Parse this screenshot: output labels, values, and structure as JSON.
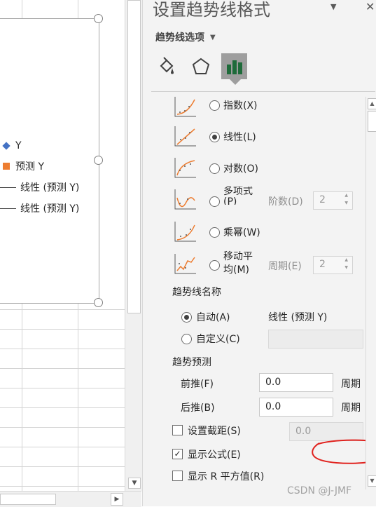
{
  "chart_legend": {
    "items": [
      "Y",
      "预测 Y",
      "线性 (预测 Y)",
      "线性 (预测 Y)"
    ]
  },
  "pane": {
    "title": "设置趋势线格式",
    "subtitle": "趋势线选项",
    "tabs": [
      "fill-line",
      "effects",
      "trendline-options"
    ],
    "trend_types": [
      {
        "label": "指数(X)",
        "selected": false
      },
      {
        "label": "线性(L)",
        "selected": true
      },
      {
        "label": "对数(O)",
        "selected": false
      },
      {
        "label": "多项式(P)",
        "selected": false,
        "param_label": "阶数(D)",
        "param_value": "2"
      },
      {
        "label": "乘幂(W)",
        "selected": false
      },
      {
        "label": "移动平均(M)",
        "selected": false,
        "param_label": "周期(E)",
        "param_value": "2"
      }
    ],
    "poly_label_line1": "多项式",
    "poly_label_line2": "(P)",
    "ma_label_line1": "移动平",
    "ma_label_line2": "均(M)",
    "trendline_name": {
      "section_label": "趋势线名称",
      "auto_label": "自动(A)",
      "auto_value": "线性 (预测 Y)",
      "custom_label": "自定义(C)",
      "auto_selected": true
    },
    "forecast": {
      "section_label": "趋势预测",
      "forward_label": "前推(F)",
      "forward_value": "0.0",
      "backward_label": "后推(B)",
      "backward_value": "0.0",
      "unit": "周期"
    },
    "set_intercept": {
      "label": "设置截距(S)",
      "checked": false,
      "value": "0.0"
    },
    "display_equation": {
      "label": "显示公式(E)",
      "checked": true
    },
    "display_r2": {
      "label": "显示 R 平方值(R)",
      "checked": false
    }
  },
  "watermark": "CSDN @J-JMF",
  "colors": {
    "series_y": "#4472c4",
    "series_pred": "#ed7d31",
    "annotation_circle": "#e0221e",
    "active_tab": "#9e9e9e"
  }
}
